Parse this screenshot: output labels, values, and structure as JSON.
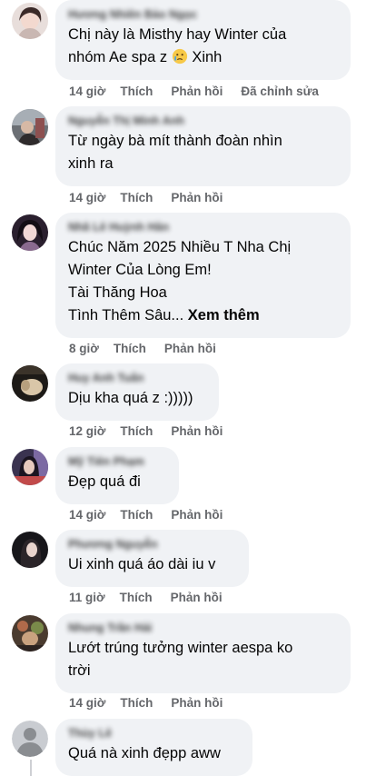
{
  "comments": [
    {
      "author": "Hương Nhiên Bảo Ngọc",
      "lines": [
        "Chị này là Misthy hay Winter của",
        "nhóm Ae spa z"
      ],
      "tail_text": " Xinh",
      "emoji": "crying-face-emoji",
      "time": "14 giờ",
      "like": "Thích",
      "reply": "Phản hồi",
      "edited": "Đã chỉnh sửa"
    },
    {
      "author": "Nguyễn Thị Minh Anh",
      "lines": [
        "Từ ngày bà mít thành đoàn nhìn",
        "xinh ra"
      ],
      "time": "14 giờ",
      "like": "Thích",
      "reply": "Phản hồi"
    },
    {
      "author": "Nhã Lê Huỳnh Hân",
      "lines": [
        "Chúc Năm 2025 Nhiều T Nha Chị",
        "Winter Của Lòng Em!",
        "Tài Thăng Hoa",
        "Tình Thêm Sâu..."
      ],
      "more": "Xem thêm",
      "time": "8 giờ",
      "like": "Thích",
      "reply": "Phản hồi"
    },
    {
      "author": "Huy Anh Tuấn",
      "lines": [
        "Dịu kha quá z :)))))"
      ],
      "time": "12 giờ",
      "like": "Thích",
      "reply": "Phản hồi"
    },
    {
      "author": "Mỹ Tiên Phạm",
      "lines": [
        "Đẹp quá đi"
      ],
      "time": "14 giờ",
      "like": "Thích",
      "reply": "Phản hồi"
    },
    {
      "author": "Phương Nguyễn",
      "lines": [
        "Ui xinh quá áo dài iu v"
      ],
      "time": "11 giờ",
      "like": "Thích",
      "reply": "Phản hồi"
    },
    {
      "author": "Nhung Trần Hải",
      "lines": [
        "Lướt trúng tưởng winter aespa ko",
        "trời"
      ],
      "time": "14 giờ",
      "like": "Thích",
      "reply": "Phản hồi"
    },
    {
      "author": "Thùy Lê",
      "lines": [
        "Quá nà xinh đẹpp aww"
      ]
    }
  ],
  "colors": {
    "bubble": "#f0f2f5",
    "text": "#050505",
    "secondary": "#65676b"
  }
}
